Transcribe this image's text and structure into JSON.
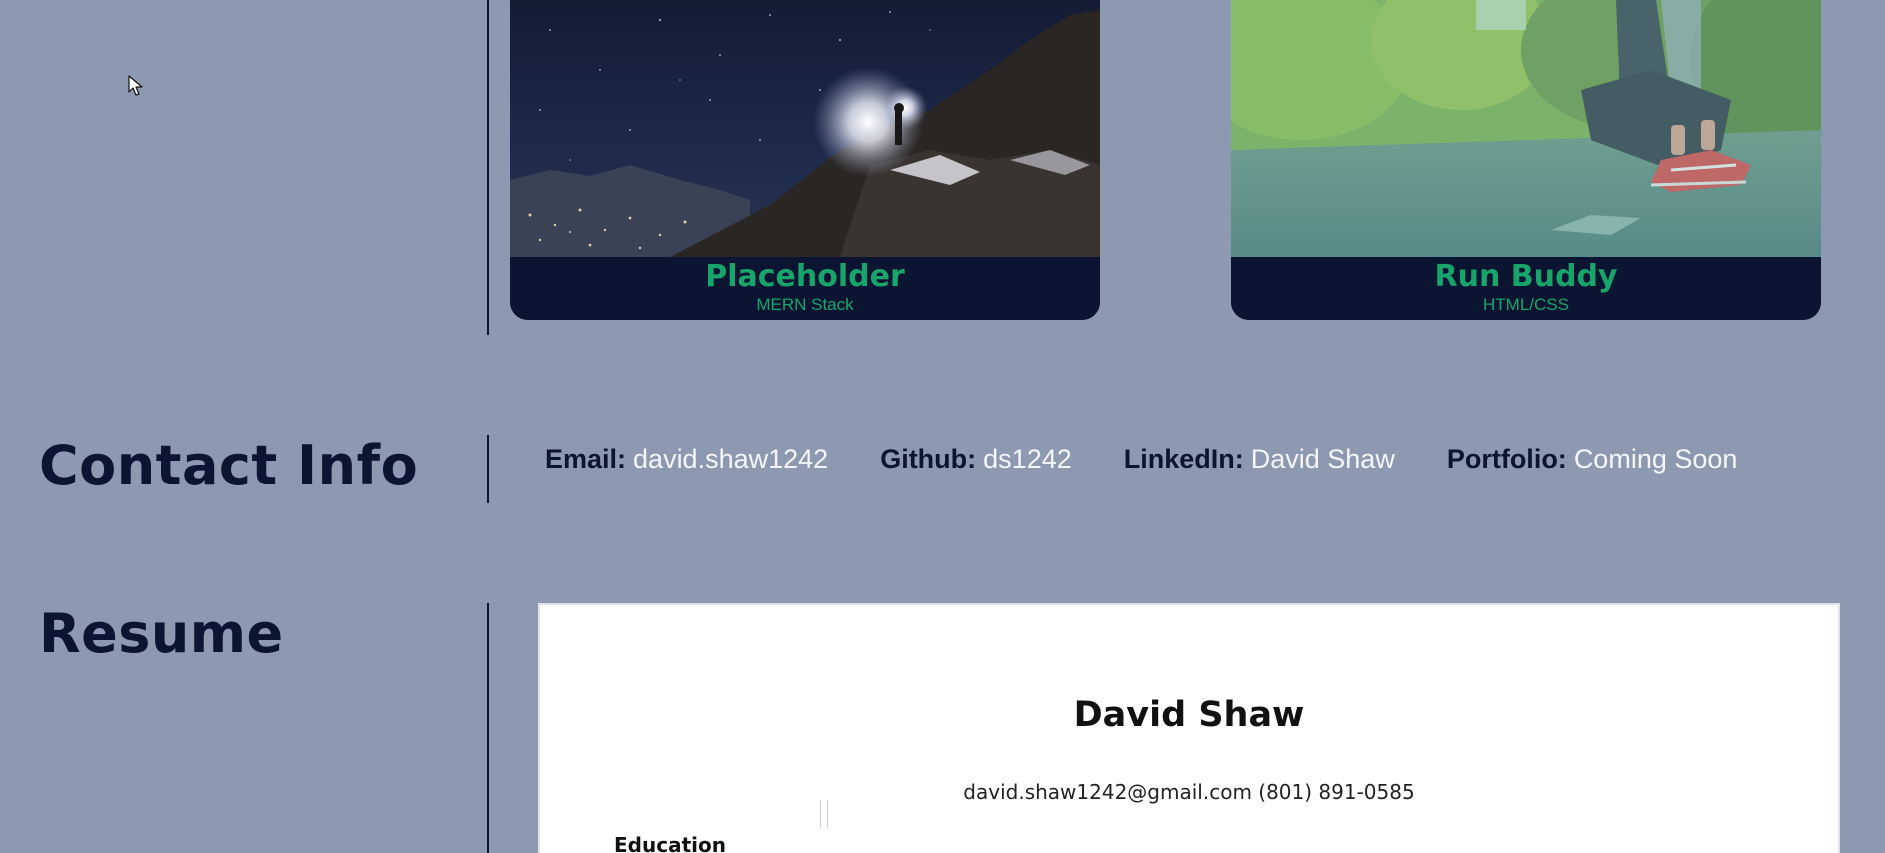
{
  "projects": [
    {
      "title": "Placeholder",
      "subtitle": "MERN Stack"
    },
    {
      "title": "Run Buddy",
      "subtitle": "HTML/CSS"
    }
  ],
  "contact": {
    "heading": "Contact Info",
    "items": [
      {
        "label": "Email:",
        "value": "david.shaw1242"
      },
      {
        "label": "Github:",
        "value": "ds1242"
      },
      {
        "label": "LinkedIn:",
        "value": "David Shaw"
      },
      {
        "label": "Portfolio:",
        "value": "Coming Soon"
      }
    ]
  },
  "resume": {
    "heading": "Resume",
    "name": "David Shaw",
    "contact_line": "david.shaw1242@gmail.com (801) 891-0585",
    "first_section": "Education"
  },
  "colors": {
    "background": "#8d99b0",
    "navy": "#0b1430",
    "accent_green": "#18a56b"
  }
}
